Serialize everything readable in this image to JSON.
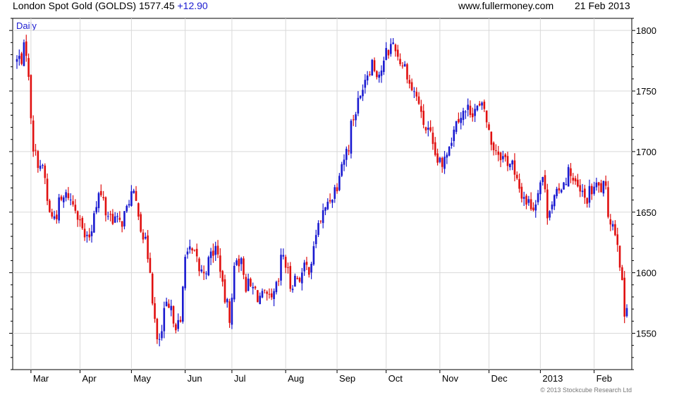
{
  "header": {
    "title": "London Spot Gold (GOLDS)",
    "last": "1577.45",
    "change": "+12.90",
    "source": "www.fullermoney.com",
    "date": "21 Feb 2013"
  },
  "copyright": "© 2013 Stockcube Research Ltd",
  "colors": {
    "up": "#1a1ad0",
    "down": "#e01010",
    "grid": "#d9d9d9",
    "axis": "#000000",
    "period_label": "#1a1ad0"
  },
  "chart_data": {
    "type": "ohlc",
    "title": "London Spot Gold (GOLDS)",
    "period": "Daily",
    "ylim": [
      1520,
      1810
    ],
    "yticks": [
      1550,
      1600,
      1650,
      1700,
      1750,
      1800
    ],
    "grid": true,
    "x_labels": [
      "Mar",
      "Apr",
      "May",
      "Jun",
      "Jul",
      "Aug",
      "Sep",
      "Oct",
      "Nov",
      "Dec",
      "2013",
      "Feb"
    ],
    "x_label_dates": [
      "2012-03-01",
      "2012-04-01",
      "2012-05-01",
      "2012-06-01",
      "2012-07-01",
      "2012-08-01",
      "2012-09-01",
      "2012-10-01",
      "2012-11-01",
      "2012-12-01",
      "2013-01-01",
      "2013-02-01"
    ],
    "series": [
      {
        "name": "GOLDS",
        "anchors": [
          [
            "2012-02-22",
            1775
          ],
          [
            "2012-02-28",
            1785
          ],
          [
            "2012-03-02",
            1705
          ],
          [
            "2012-03-07",
            1690
          ],
          [
            "2012-03-14",
            1645
          ],
          [
            "2012-03-23",
            1665
          ],
          [
            "2012-03-28",
            1655
          ],
          [
            "2012-04-04",
            1625
          ],
          [
            "2012-04-11",
            1665
          ],
          [
            "2012-04-16",
            1650
          ],
          [
            "2012-04-24",
            1640
          ],
          [
            "2012-05-01",
            1665
          ],
          [
            "2012-05-07",
            1640
          ],
          [
            "2012-05-14",
            1580
          ],
          [
            "2012-05-16",
            1540
          ],
          [
            "2012-05-22",
            1570
          ],
          [
            "2012-05-30",
            1555
          ],
          [
            "2012-06-01",
            1620
          ],
          [
            "2012-06-06",
            1615
          ],
          [
            "2012-06-12",
            1600
          ],
          [
            "2012-06-20",
            1620
          ],
          [
            "2012-06-28",
            1565
          ],
          [
            "2012-07-03",
            1615
          ],
          [
            "2012-07-09",
            1590
          ],
          [
            "2012-07-17",
            1580
          ],
          [
            "2012-07-24",
            1575
          ],
          [
            "2012-07-31",
            1615
          ],
          [
            "2012-08-03",
            1590
          ],
          [
            "2012-08-15",
            1605
          ],
          [
            "2012-08-22",
            1645
          ],
          [
            "2012-08-29",
            1665
          ],
          [
            "2012-09-06",
            1700
          ],
          [
            "2012-09-13",
            1740
          ],
          [
            "2012-09-21",
            1775
          ],
          [
            "2012-09-26",
            1765
          ],
          [
            "2012-10-04",
            1790
          ],
          [
            "2012-10-11",
            1770
          ],
          [
            "2012-10-18",
            1745
          ],
          [
            "2012-10-25",
            1715
          ],
          [
            "2012-11-02",
            1685
          ],
          [
            "2012-11-12",
            1730
          ],
          [
            "2012-11-20",
            1735
          ],
          [
            "2012-11-28",
            1735
          ],
          [
            "2012-11-30",
            1715
          ],
          [
            "2012-12-06",
            1700
          ],
          [
            "2012-12-14",
            1690
          ],
          [
            "2012-12-20",
            1665
          ],
          [
            "2012-12-27",
            1655
          ],
          [
            "2013-01-02",
            1680
          ],
          [
            "2013-01-04",
            1650
          ],
          [
            "2013-01-11",
            1665
          ],
          [
            "2013-01-18",
            1685
          ],
          [
            "2013-01-24",
            1665
          ],
          [
            "2013-01-28",
            1660
          ],
          [
            "2013-02-01",
            1670
          ],
          [
            "2013-02-07",
            1670
          ],
          [
            "2013-02-11",
            1650
          ],
          [
            "2013-02-14",
            1635
          ],
          [
            "2013-02-18",
            1610
          ],
          [
            "2013-02-20",
            1565
          ],
          [
            "2013-02-21",
            1577.45
          ]
        ]
      }
    ]
  }
}
